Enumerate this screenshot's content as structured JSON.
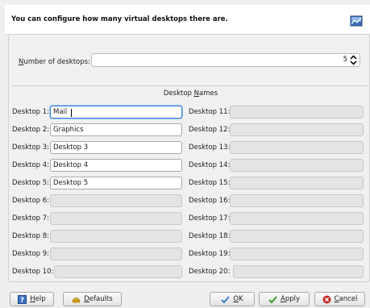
{
  "header": {
    "text": "You can configure how many virtual desktops there are."
  },
  "count": {
    "label_u": "N",
    "label_rest": "umber of desktops:",
    "value": "5"
  },
  "names": {
    "title_pre": "Desktop ",
    "title_u": "N",
    "title_rest": "ames"
  },
  "desktops": [
    {
      "label": "Desktop 1:",
      "value": "Mail"
    },
    {
      "label": "Desktop 2:",
      "value": "Graphics"
    },
    {
      "label": "Desktop 3:",
      "value": "Desktop 3"
    },
    {
      "label": "Desktop 4:",
      "value": "Desktop 4"
    },
    {
      "label": "Desktop 5:",
      "value": "Desktop 5"
    },
    {
      "label": "Desktop 6:",
      "value": ""
    },
    {
      "label": "Desktop 7:",
      "value": ""
    },
    {
      "label": "Desktop 8:",
      "value": ""
    },
    {
      "label": "Desktop 9:",
      "value": ""
    },
    {
      "label": "Desktop 10:",
      "value": ""
    },
    {
      "label": "Desktop 11:",
      "value": ""
    },
    {
      "label": "Desktop 12:",
      "value": ""
    },
    {
      "label": "Desktop 13:",
      "value": ""
    },
    {
      "label": "Desktop 14:",
      "value": ""
    },
    {
      "label": "Desktop 15:",
      "value": ""
    },
    {
      "label": "Desktop 16:",
      "value": ""
    },
    {
      "label": "Desktop 17:",
      "value": ""
    },
    {
      "label": "Desktop 18:",
      "value": ""
    },
    {
      "label": "Desktop 19:",
      "value": ""
    },
    {
      "label": "Desktop 20:",
      "value": ""
    }
  ],
  "buttons": {
    "help_u": "H",
    "help_rest": "elp",
    "defaults_u": "D",
    "defaults_rest": "efaults",
    "ok_u": "O",
    "ok_rest": "K",
    "apply_u": "A",
    "apply_rest": "pply",
    "cancel_u": "C",
    "cancel_rest": "ancel"
  },
  "colors": {
    "focus": "#3d7ed6",
    "ok_check": "#3f7dc9",
    "apply_check": "#3a9a2a",
    "cancel": "#c92a2a"
  }
}
